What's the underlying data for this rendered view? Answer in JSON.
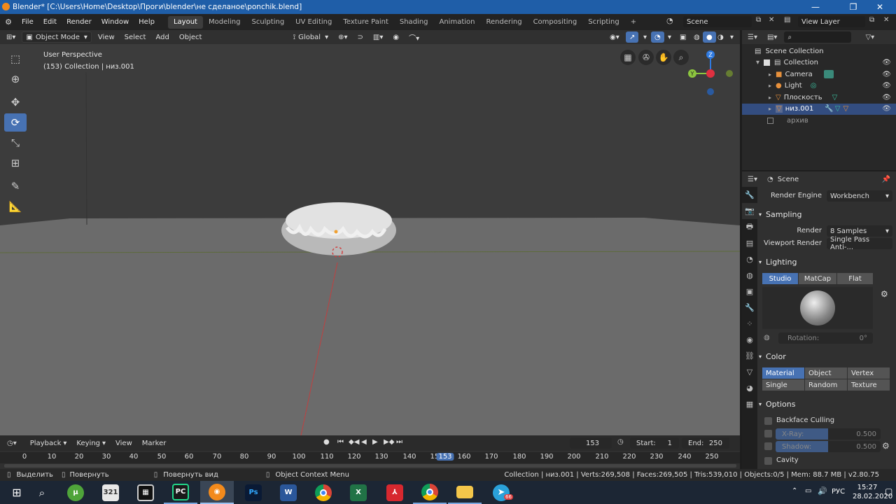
{
  "title_bar": {
    "title": "Blender* [C:\\Users\\Home\\Desktop\\Проги\\blender\\не сделаное\\ponchik.blend]"
  },
  "menu": {
    "items": [
      "File",
      "Edit",
      "Render",
      "Window",
      "Help"
    ]
  },
  "workspaces": {
    "tabs": [
      "Layout",
      "Modeling",
      "Sculpting",
      "UV Editing",
      "Texture Paint",
      "Shading",
      "Animation",
      "Rendering",
      "Compositing",
      "Scripting"
    ],
    "active": "Layout",
    "add": "+"
  },
  "scene_selector": {
    "value": "Scene"
  },
  "view_layer": {
    "value": "View Layer"
  },
  "viewport_header": {
    "mode": "Object Mode",
    "view": "View",
    "select": "Select",
    "add": "Add",
    "object": "Object",
    "transform_orientation": "Global"
  },
  "viewport": {
    "perspective": "User Perspective",
    "collection_info": "(153) Collection | низ.001"
  },
  "gizmo": {
    "z": "Z",
    "y": "Y"
  },
  "outliner": {
    "root": "Scene Collection",
    "items": [
      {
        "label": "Collection",
        "icon": "collection-icon"
      },
      {
        "label": "Camera",
        "icon": "camera-icon"
      },
      {
        "label": "Light",
        "icon": "light-icon"
      },
      {
        "label": "Плоскость",
        "icon": "mesh-icon"
      },
      {
        "label": "низ.001",
        "icon": "mesh-icon",
        "selected": true
      },
      {
        "label": "архив",
        "icon": "collection-icon"
      }
    ]
  },
  "properties": {
    "context": "Scene",
    "render_engine_label": "Render Engine",
    "render_engine": "Workbench",
    "sampling": {
      "title": "Sampling",
      "render_label": "Render",
      "render": "8 Samples",
      "viewport_label": "Viewport Render",
      "viewport": "Single Pass Anti-..."
    },
    "lighting": {
      "title": "Lighting",
      "options": [
        "Studio",
        "MatCap",
        "Flat"
      ],
      "active": "Studio",
      "rotation_label": "Rotation:",
      "rotation_value": "0°"
    },
    "color": {
      "title": "Color",
      "options": [
        "Material",
        "Object",
        "Vertex",
        "Single",
        "Random",
        "Texture"
      ],
      "active": "Material"
    },
    "options": {
      "title": "Options",
      "backface": "Backface Culling",
      "xray_label": "X-Ray:",
      "xray_value": "0.500",
      "xray_level": 0.5,
      "shadow_label": "Shadow:",
      "shadow_value": "0.500",
      "shadow_level": 0.5,
      "cavity": "Cavity"
    }
  },
  "timeline": {
    "playback": "Playback",
    "keying": "Keying",
    "view": "View",
    "marker": "Marker",
    "current_frame": "153",
    "start_label": "Start:",
    "start": "1",
    "end_label": "End:",
    "end": "250",
    "ticks": [
      "0",
      "10",
      "20",
      "30",
      "40",
      "50",
      "60",
      "70",
      "80",
      "90",
      "100",
      "110",
      "120",
      "130",
      "140",
      "150",
      "153",
      "160",
      "170",
      "180",
      "190",
      "200",
      "210",
      "220",
      "230",
      "240",
      "250"
    ]
  },
  "status_bar": {
    "select": "Выделить",
    "rotate": "Повернуть",
    "rotate_view": "Повернуть вид",
    "context_menu": "Object Context Menu",
    "stats": "Collection | низ.001 | Verts:269,508 | Faces:269,505 | Tris:539,010 | Objects:0/5 | Mem: 88.7 MB | v2.80.75"
  },
  "taskbar": {
    "lang": "РУС",
    "time": "15:27",
    "date": "28.02.2020",
    "telegram_badge": "66",
    "calendar": "321",
    "ps": "Ps"
  },
  "colors": {
    "accent": "#4772b3",
    "title": "#1f5ea8",
    "axis_x": "#c04040",
    "axis_y": "#8cc63f",
    "axis_z": "#2f7ae0"
  }
}
